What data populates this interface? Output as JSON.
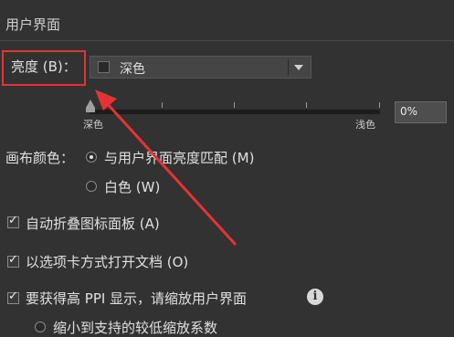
{
  "section": {
    "title": "用户界面"
  },
  "brightness": {
    "label": "亮度 (B)：",
    "selected": "深色",
    "slider_min_label": "深色",
    "slider_max_label": "浅色",
    "percent_value": "0%",
    "slider_level": 0
  },
  "canvas_color": {
    "label": "画布颜色：",
    "options": [
      {
        "label": "与用户界面亮度匹配 (M)",
        "checked": true
      },
      {
        "label": "白色 (W)",
        "checked": false
      }
    ]
  },
  "checkboxes": [
    {
      "label": "自动折叠图标面板 (A)",
      "checked": true
    },
    {
      "label": "以选项卡方式打开文档 (O)",
      "checked": true
    },
    {
      "label": "要获得高 PPI 显示，请缩放用户界面",
      "checked": true
    }
  ],
  "scale_option": {
    "label": "缩小到支持的较低缩放系数",
    "checked": false
  },
  "annotation": {
    "highlight_color": "#e53333"
  },
  "icons": {
    "info": "info-icon",
    "dropdown_arrow": "chevron-down-icon"
  }
}
